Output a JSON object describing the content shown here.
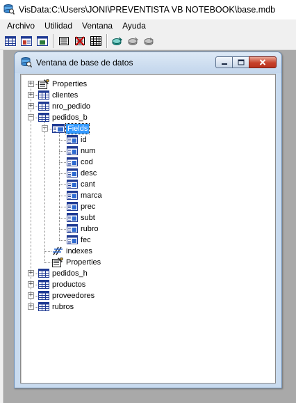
{
  "app": {
    "title": "VisData:C:\\Users\\JONI\\PREVENTISTA  VB NOTEBOOK\\base.mdb"
  },
  "menu": [
    {
      "label": "Archivo"
    },
    {
      "label": "Utilidad"
    },
    {
      "label": "Ventana"
    },
    {
      "label": "Ayuda"
    }
  ],
  "toolbar": {
    "buttons": [
      {
        "icon": "table-mode-icon"
      },
      {
        "icon": "dynaset-mode-icon"
      },
      {
        "icon": "snapshot-mode-icon"
      },
      {
        "icon": "data-control-icon"
      },
      {
        "icon": "no-data-control-icon"
      },
      {
        "icon": "grid-icon"
      },
      {
        "icon": "begin-transaction-icon"
      },
      {
        "icon": "commit-icon"
      },
      {
        "icon": "rollback-icon"
      }
    ]
  },
  "child_window": {
    "title": "Ventana de base de datos"
  },
  "tree": {
    "nodes": [
      {
        "label": "Properties",
        "icon": "properties-icon",
        "expander": "+"
      },
      {
        "label": "clientes",
        "icon": "table-icon",
        "expander": "+"
      },
      {
        "label": "nro_pedido",
        "icon": "table-icon",
        "expander": "+"
      },
      {
        "label": "pedidos_b",
        "icon": "table-icon",
        "expander": "-",
        "children": [
          {
            "label": "Fields",
            "icon": "fields-icon",
            "expander": "-",
            "selected": true,
            "children": [
              {
                "label": "id"
              },
              {
                "label": "num"
              },
              {
                "label": "cod"
              },
              {
                "label": "desc"
              },
              {
                "label": "cant"
              },
              {
                "label": "marca"
              },
              {
                "label": "prec"
              },
              {
                "label": "subt"
              },
              {
                "label": "rubro"
              },
              {
                "label": "fec"
              }
            ]
          },
          {
            "label": "indexes",
            "icon": "indexes-icon"
          },
          {
            "label": "Properties",
            "icon": "properties-icon"
          }
        ]
      },
      {
        "label": "pedidos_h",
        "icon": "table-icon",
        "expander": "+"
      },
      {
        "label": "productos",
        "icon": "table-icon",
        "expander": "+"
      },
      {
        "label": "proveedores",
        "icon": "table-icon",
        "expander": "+"
      },
      {
        "label": "rubros",
        "icon": "table-icon",
        "expander": "+"
      }
    ]
  },
  "colors": {
    "selection": "#3399ff",
    "workspace": "#a9a9a9",
    "close_button": "#c7412b"
  }
}
